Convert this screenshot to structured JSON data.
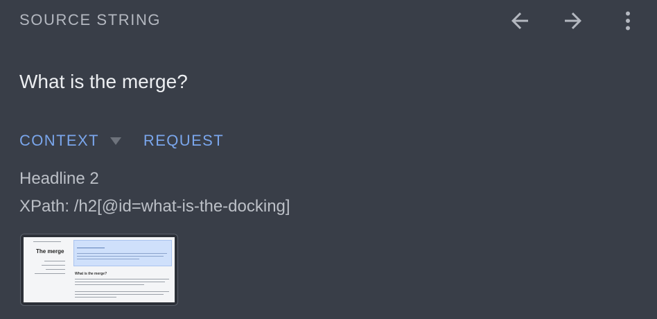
{
  "header": {
    "label": "SOURCE STRING",
    "back_icon": "arrow-left-icon",
    "forward_icon": "arrow-right-icon",
    "menu_icon": "more-vert-icon"
  },
  "source": {
    "text": "What is the merge?"
  },
  "tabs": [
    {
      "label": "CONTEXT",
      "active": true,
      "has_dropdown": true
    },
    {
      "label": "REQUEST",
      "active": false
    }
  ],
  "context": {
    "element_type": "Headline 2",
    "xpath": "XPath: /h2[@id=what-is-the-docking]"
  },
  "screenshot_thumbnail": {
    "heading": "The merge",
    "subheading": "What is the merge?"
  },
  "colors": {
    "background": "#393e48",
    "accent": "#7aa6ec",
    "muted_text": "#b4b8c0"
  }
}
